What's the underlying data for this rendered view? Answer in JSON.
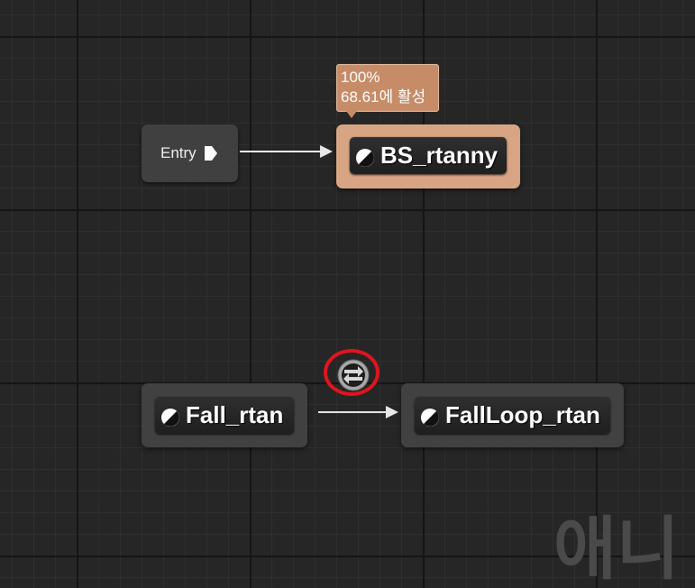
{
  "entry": {
    "label": "Entry",
    "icon": "entry-arrow-icon"
  },
  "states": {
    "active": {
      "name": "BS_rtanny",
      "icon": "state-icon",
      "tooltip": {
        "weight": "100%",
        "active_for": "68.61에 활성"
      }
    },
    "fall": {
      "name": "Fall_rtan",
      "icon": "state-icon"
    },
    "fall_loop": {
      "name": "FallLoop_rtan",
      "icon": "state-icon"
    }
  },
  "transition": {
    "icon": "transition-rule-icon",
    "highlight_color": "#e0141e"
  },
  "watermark": "애니",
  "colors": {
    "active_state": "#d8a584",
    "tooltip": "#c68c67",
    "node": "#414141",
    "background": "#262626"
  }
}
